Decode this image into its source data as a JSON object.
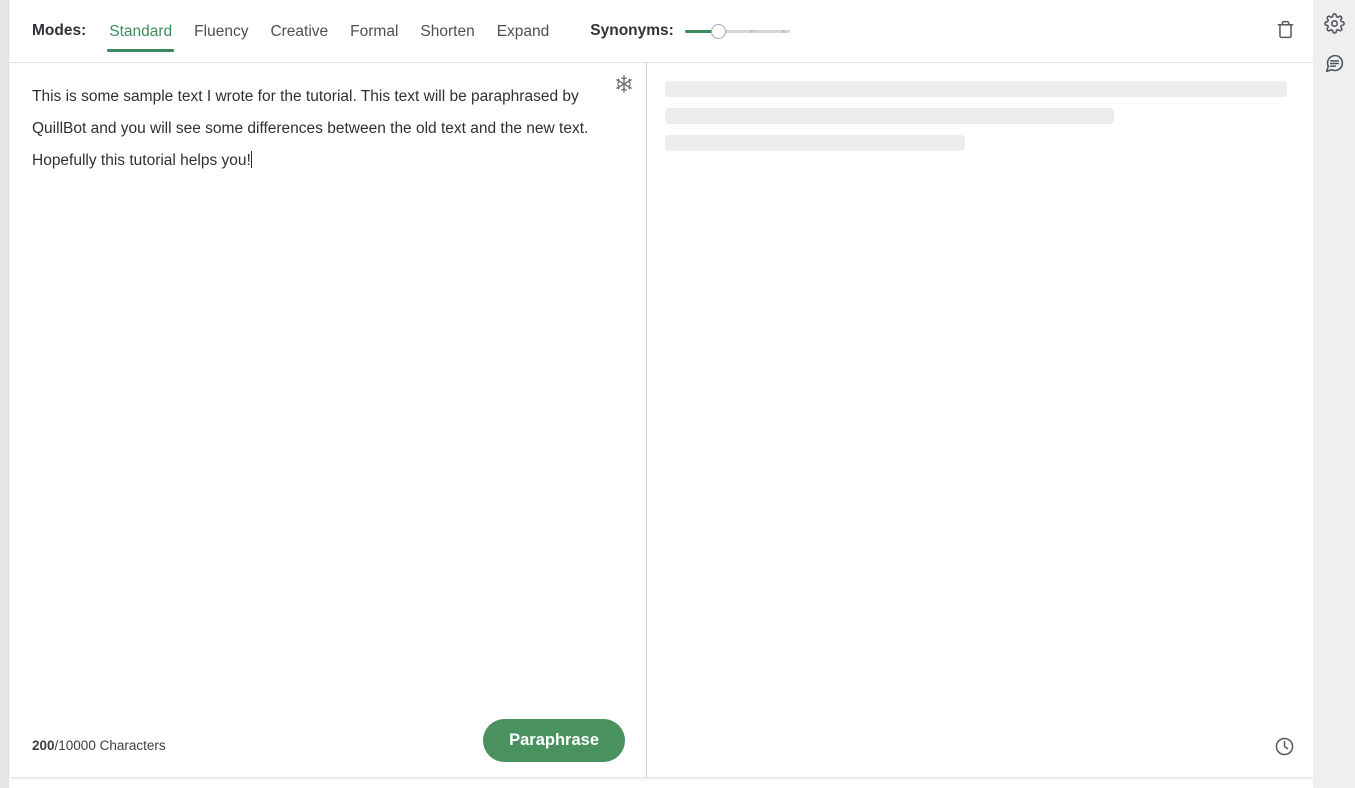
{
  "toolbar": {
    "modes_label": "Modes:",
    "modes": [
      {
        "label": "Standard",
        "active": true
      },
      {
        "label": "Fluency",
        "active": false
      },
      {
        "label": "Creative",
        "active": false
      },
      {
        "label": "Formal",
        "active": false
      },
      {
        "label": "Shorten",
        "active": false
      },
      {
        "label": "Expand",
        "active": false
      }
    ],
    "synonyms_label": "Synonyms:",
    "synonyms_value": 30,
    "delete_icon": "trash-icon"
  },
  "input_pane": {
    "text": "This is some sample text I wrote for the tutorial. This text will be paraphrased by QuillBot and you will see some differences between the old text and the new text. Hopefully this tutorial helps you!",
    "freeze_icon": "snowflake-icon",
    "char_count_current": "200",
    "char_count_rest": "/10000 Characters",
    "paraphrase_label": "Paraphrase"
  },
  "output_pane": {
    "skeleton_widths": [
      "100%",
      "75%",
      "50%"
    ],
    "history_icon": "clock-icon"
  },
  "right_rail": {
    "items": [
      {
        "icon": "gear-icon"
      },
      {
        "icon": "chat-icon"
      }
    ]
  },
  "colors": {
    "accent_green": "#3c8b5f",
    "button_green": "#4a9160",
    "skeleton_gray": "#ececec",
    "rail_gray": "#efefef"
  }
}
